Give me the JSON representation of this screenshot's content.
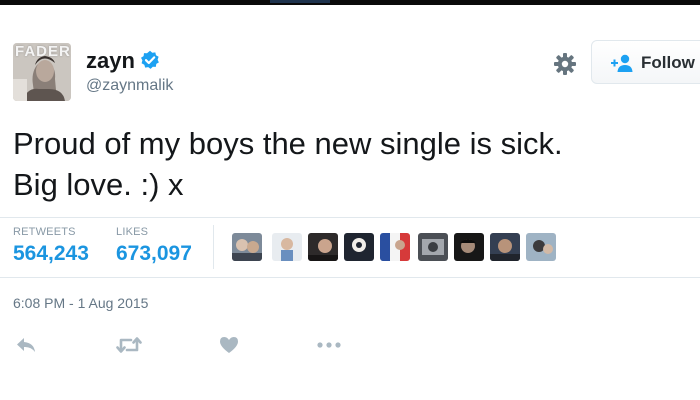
{
  "avatar": {
    "brand_text": "FADER"
  },
  "user": {
    "display_name": "zayn",
    "screen_name": "@zaynmalik",
    "verified": true
  },
  "header": {
    "follow_label": "Follow"
  },
  "tweet": {
    "text_lines": [
      "Proud of my boys the new single is sick.",
      "Big love. :) x"
    ]
  },
  "stats": {
    "retweets_label": "RETWEETS",
    "retweets_count": "564,243",
    "likes_label": "LIKES",
    "likes_count": "673,097"
  },
  "timestamp": "6:08 PM - 1 Aug 2015",
  "colors": {
    "link_blue": "#1b95e0",
    "verified_blue": "#1da1f2",
    "muted_gray": "#657786",
    "icon_gray": "#aab8c2",
    "divider": "#e1e8ed"
  },
  "icons": [
    "verified-badge-icon",
    "gear-icon",
    "follow-user-icon",
    "reply-icon",
    "retweet-icon",
    "like-heart-icon",
    "more-dots-icon"
  ]
}
